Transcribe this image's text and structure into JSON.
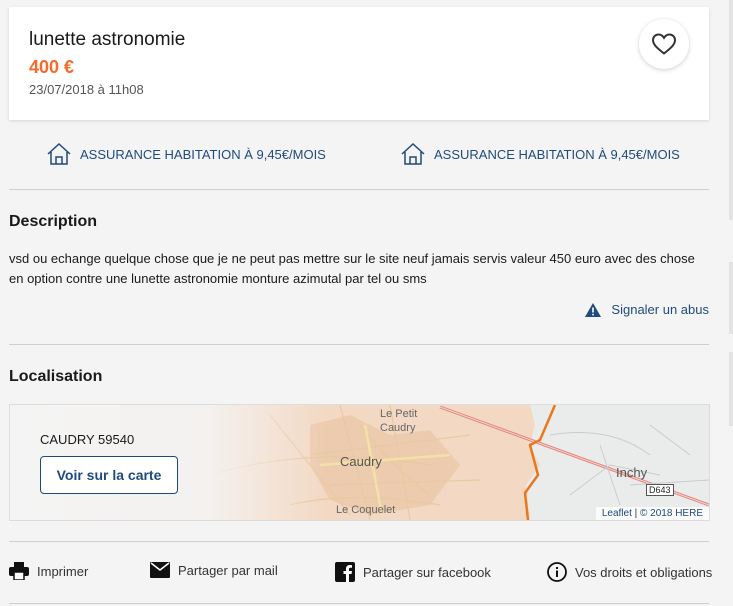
{
  "listing": {
    "title": "lunette astronomie",
    "price": "400 €",
    "date": "23/07/2018 à 11h08"
  },
  "insurance": {
    "left_label": "ASSURANCE HABITATION À 9,45€/MOIS",
    "right_label": "ASSURANCE HABITATION À 9,45€/MOIS"
  },
  "description": {
    "heading": "Description",
    "text": "vsd ou echange quelque chose que je ne peut pas mettre sur le site neuf jamais servis valeur 450 euro avec des chose en option contre une lunette astronomie monture azimutal par tel ou sms",
    "report_label": "Signaler un abus"
  },
  "location": {
    "heading": "Localisation",
    "city": "CAUDRY 59540",
    "map_button": "Voir sur la carte",
    "map_labels": {
      "town_main": "Caudry",
      "town_petit": "Le Petit",
      "town_petit2": "Caudry",
      "town_coquelet": "Le Coquelet",
      "town_inchy": "Inchy",
      "road": "D643"
    },
    "attribution_link": "Leaflet",
    "attribution_sep": " | ",
    "attribution_text": "© 2018 HERE"
  },
  "actions": {
    "print": "Imprimer",
    "mail": "Partager par mail",
    "facebook": "Partager sur facebook",
    "rights": "Vos droits et obligations"
  },
  "colors": {
    "accent": "#f56b2a",
    "link": "#1f4b7a"
  }
}
